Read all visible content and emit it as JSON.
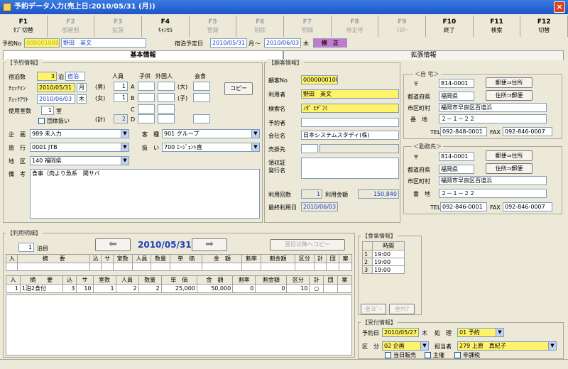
{
  "window": {
    "title": "予約データ入力(売上日:2010/05/31 (月))",
    "close": "×"
  },
  "fkeys": [
    {
      "key": "F1",
      "label": "ﾀﾌﾞ切替",
      "enabled": true
    },
    {
      "key": "F2",
      "label": "部屋割",
      "enabled": false
    },
    {
      "key": "F3",
      "label": "拡張",
      "enabled": false
    },
    {
      "key": "F4",
      "label": "ｷｬﾝｾﾙ",
      "enabled": true
    },
    {
      "key": "F5",
      "label": "登録",
      "enabled": false
    },
    {
      "key": "F6",
      "label": "削除",
      "enabled": false
    },
    {
      "key": "F7",
      "label": "明細",
      "enabled": false
    },
    {
      "key": "F8",
      "label": "修正呼",
      "enabled": false
    },
    {
      "key": "F9",
      "label": "ﾏｽﾀｰ",
      "enabled": false
    },
    {
      "key": "F10",
      "label": "終了",
      "enabled": true
    },
    {
      "key": "F11",
      "label": "検索",
      "enabled": true
    },
    {
      "key": "F12",
      "label": "切替",
      "enabled": true
    }
  ],
  "header": {
    "yoyaku_no_label": "予約No",
    "yoyaku_no": "0000018883",
    "name": "野田　英文",
    "stay_label": "宿泊予定日",
    "date_from": "2010/05/31",
    "dow_from": "月",
    "tilde": "～",
    "date_to": "2010/06/03",
    "dow_to": "木",
    "status": "修　正"
  },
  "tabs": {
    "basic": "基本情報",
    "extended": "拡張情報"
  },
  "yoyaku": {
    "group": "【予約情報】",
    "stay_nights_label": "宿泊数",
    "stay_nights": "3",
    "haku": "泊",
    "stay_type": "宿泊",
    "checkin_label": "ﾁｪｯｸｲﾝ",
    "checkin": "2010/05/31",
    "checkin_dow": "月",
    "checkout_label": "ﾁｪｯｸｱｳﾄ",
    "checkout": "2010/06/03",
    "checkout_dow": "木",
    "rooms_label": "使用室数",
    "rooms": "1",
    "rooms_unit": "室",
    "group_label": "団体扱い",
    "persons_label": "人員",
    "child_label": "子供",
    "foreign_label": "外国人",
    "meal_label": "会食",
    "male_label": "(男)",
    "male": "1",
    "female_label": "(女)",
    "female": "1",
    "total_label": "(計)",
    "total": "2",
    "a": "A",
    "b": "B",
    "c": "C",
    "d": "D",
    "adult_label": "(大)",
    "child_s_label": "(子)",
    "copy": "コピー",
    "kikaku_label": "企　画",
    "kikaku": "989 未入力",
    "kyakushu_label": "客　種",
    "kyakushu": "901 グループ",
    "ryokou_label": "旅　行",
    "ryokou": "0001 JTB",
    "atsukai_label": "扱　い",
    "atsukai": "700 ｴｰｼﾞｪﾝﾄ直",
    "chiku_label": "地　区",
    "chiku": "140 福岡県",
    "bikou_label": "備　考",
    "bikou": "食事（肉より魚系　関サバ"
  },
  "kokyaku": {
    "group": "【顧客情報】",
    "no_label": "顧客No",
    "no": "0000000100",
    "user_label": "利用者",
    "user": "野田　英文",
    "kana_label": "検索名",
    "kana": "ﾉﾀﾞ ﾋﾃﾞﾌﾐ",
    "yoyakusha_label": "予約者",
    "yoyakusha": "",
    "company_label": "会社名",
    "company": "日本システムスタディ(株)",
    "sendsaki_label": "売掛先",
    "ryoshu_label": "領収証\n発行名",
    "count_label": "利用回数",
    "count": "1",
    "amount_label": "利用金額",
    "amount": "150,840",
    "last_label": "最終利用日",
    "last": "2010/06/03"
  },
  "home": {
    "group": "＜自 宅＞",
    "zip_label": "〒",
    "zip": "814-0001",
    "pref_label": "都道府県",
    "pref": "福岡県",
    "city_label": "市区町村",
    "city": "福岡市早良区百道浜",
    "addr_label": "番　地",
    "addr": "２－１－２２",
    "tel_label": "TEL",
    "tel": "092-848-0001",
    "fax_label": "FAX",
    "fax": "092-846-0007",
    "btn1": "郵便⇒住所",
    "btn2": "住所⇒郵便"
  },
  "work": {
    "group": "＜勤務先＞",
    "zip_label": "〒",
    "zip": "814-0001",
    "pref_label": "都道府県",
    "pref": "福岡県",
    "city_label": "市区町村",
    "city": "福岡市早良区百道浜",
    "addr_label": "番　地",
    "addr": "２－１－２２",
    "tel_label": "TEL",
    "tel": "092-846-0001",
    "fax_label": "FAX",
    "fax": "092-846-0007",
    "btn1": "郵便⇒住所",
    "btn2": "住所⇒郵便"
  },
  "meisai": {
    "group": "【利用明細】",
    "nights": "1",
    "nights_unit": "泊目",
    "date": "2010/05/31",
    "next_copy": "翌日以降へコピー",
    "head1": [
      "入",
      "摘　　要",
      "込",
      "サ",
      "室数",
      "人員",
      "数量",
      "単　価",
      "金　額",
      "割率",
      "割金額",
      "区分",
      "計",
      "団",
      "案"
    ],
    "row": [
      "1",
      "1泊2食付",
      "3",
      "10",
      "1",
      "2",
      "2",
      "25,000",
      "50,000",
      "0",
      "0",
      "10",
      "○",
      "",
      ""
    ]
  },
  "shokuji": {
    "group": "【食事情報】",
    "time_header": "時間",
    "rows": [
      [
        "1",
        "19:00"
      ],
      [
        "2",
        "19:00"
      ],
      [
        "3",
        "19:00"
      ]
    ],
    "all_copy": "全ｺﾋﾟｰ",
    "all_clear": "全ｸﾘｱ"
  },
  "uketsuke": {
    "group": "【受付情報】",
    "date_label": "予約日",
    "date": "2010/05/27",
    "dow": "木",
    "shori_label": "処　理",
    "shori": "01 予約",
    "kubun_label": "区　分",
    "kubun": "02 企画",
    "tanto_label": "担当者",
    "tanto": "279 上原　真紀子",
    "c1": "当日販売",
    "c2": "主催",
    "c3": "非課税"
  }
}
